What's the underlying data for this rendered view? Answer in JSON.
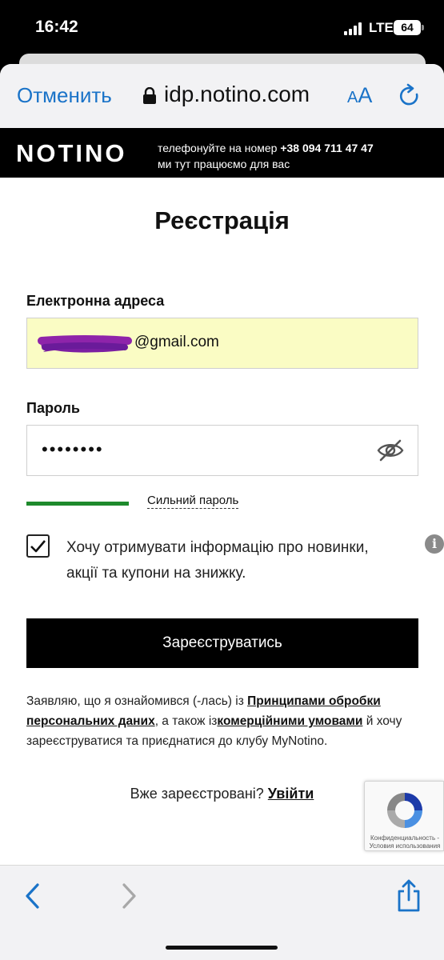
{
  "status_bar": {
    "time": "16:42",
    "network": "LTE",
    "battery": "64"
  },
  "browser": {
    "cancel_label": "Отменить",
    "url": "idp.notino.com",
    "text_size_small": "A",
    "text_size_big": "A",
    "icons": [
      "lock-icon",
      "reload-icon",
      "back-icon",
      "forward-icon",
      "share-icon"
    ]
  },
  "header": {
    "logo": "NOTINO",
    "phone_prefix": "телефонуйте на номер",
    "phone_number": "+38 094 711 47 47",
    "phone_line2": "ми тут працюємо для вас"
  },
  "form": {
    "title": "Реєстрація",
    "email_label": "Електронна адреса",
    "email_value": "@gmail.com",
    "password_label": "Пароль",
    "password_value": "••••••••",
    "strength_label": "Сильний пароль",
    "newsletter_checked": true,
    "newsletter_text": "Хочу отримувати інформацію про новинки, акції та купони на знижку.",
    "register_label": "Зареєструватись",
    "consent_part1": "Заявляю, що я ознайомився (-лась) із ",
    "consent_link1": "Принципами обробки персональних даних",
    "consent_part2": ", а також із",
    "consent_link2": "комерційними умовами",
    "consent_part3": " й хочу зареєструватися та приєднатися до клубу MyNotino.",
    "login_prompt": "Вже зареєстровані? ",
    "login_link": "Увійти"
  },
  "recaptcha": {
    "line1": "Конфиденциальность -",
    "line2": "Условия использования"
  },
  "colors": {
    "accent_blue": "#1a73c8",
    "strength_green": "#1e8a2c",
    "autofill_yellow": "#fafcc4"
  }
}
